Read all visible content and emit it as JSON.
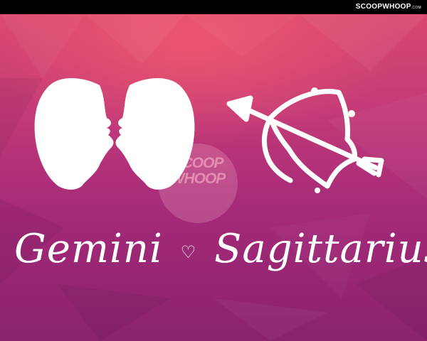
{
  "header": {
    "brand": "SCOOPWHOOP",
    "brand_suffix": ".COM"
  },
  "watermark": {
    "line1": "SCOOP",
    "line2": "WHOOP"
  },
  "caption": {
    "left": "Gemini",
    "separator": "♡",
    "right": "Sagittarius"
  },
  "icons": {
    "left": "gemini-twin-silhouettes-icon",
    "right": "sagittarius-bow-and-arrow-icon"
  },
  "colors": {
    "top_bar": "#000000",
    "background_top": "#d9486f",
    "background_bottom": "#8a2270",
    "foreground": "#ffffff"
  }
}
